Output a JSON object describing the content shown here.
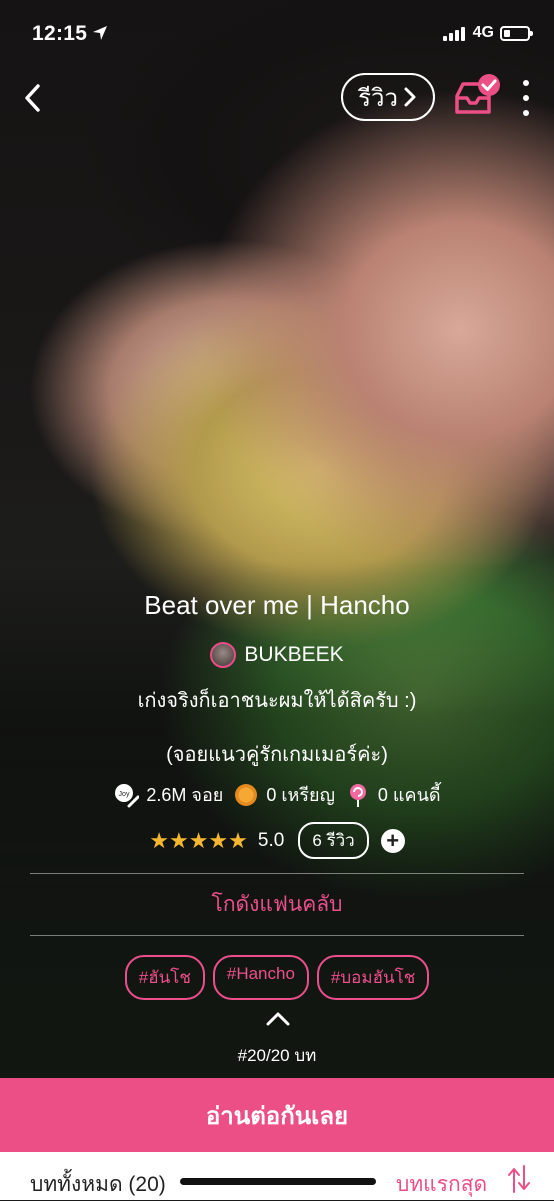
{
  "status": {
    "time": "12:15",
    "network": "4G"
  },
  "topbar": {
    "review_label": "รีวิว"
  },
  "novel": {
    "title": "Beat over me | Hancho",
    "author": "BUKBEEK",
    "description_line1": "เก่งจริงก็เอาชนะผมให้ได้สิครับ :)",
    "description_line2": "(จอยแนวคู่รักเกมเมอร์ค่ะ)"
  },
  "stats": {
    "joins": "2.6M จอย",
    "coins": "0 เหรียญ",
    "candies": "0 แคนดี้"
  },
  "rating": {
    "stars": 5,
    "score": "5.0",
    "reviews": "6 รีวิว",
    "star_glyph": "★★★★★"
  },
  "fanclub_label": "โกดังแฟนคลับ",
  "tags": [
    "#ฮันโช",
    "#Hancho",
    "#บอมฮันโช"
  ],
  "chapter_count": "#20/20 บท",
  "read_button": "อ่านต่อกันเลย",
  "bottom": {
    "all_chapters": "บททั้งหมด (20)",
    "first_chapter": "บทแรกสุด"
  },
  "colors": {
    "accent": "#ec4f86",
    "star": "#f5b630"
  }
}
